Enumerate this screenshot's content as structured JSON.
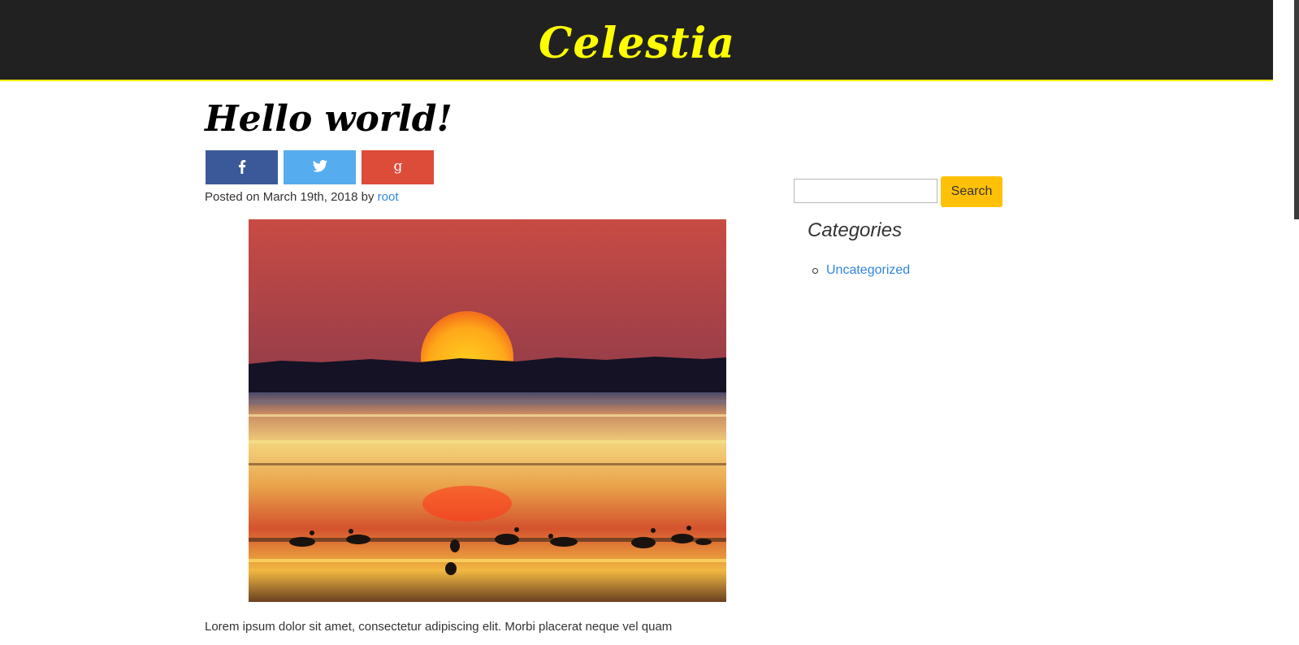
{
  "header": {
    "site_title": "Celestia"
  },
  "post": {
    "title": "Hello world!",
    "meta": {
      "prefix": "Posted on March 19th, 2018 by ",
      "author": "root"
    },
    "excerpt": "Lorem ipsum dolor sit amet, consectetur adipiscing elit. Morbi placerat neque vel quam",
    "share_buttons": [
      {
        "network": "facebook",
        "icon": "facebook-icon",
        "color": "#3b5998"
      },
      {
        "network": "twitter",
        "icon": "twitter-icon",
        "color": "#55acee"
      },
      {
        "network": "google-plus",
        "icon": "google-plus-icon",
        "color": "#dd4b39"
      }
    ]
  },
  "sidebar": {
    "search": {
      "placeholder": "",
      "button_label": "Search"
    },
    "categories": {
      "title": "Categories",
      "items": [
        "Uncategorized"
      ]
    }
  },
  "colors": {
    "header_bg": "#212121",
    "header_accent": "#ffee00",
    "title_yellow": "#ffff00",
    "link": "#2e86de",
    "search_button": "#ffc107"
  }
}
